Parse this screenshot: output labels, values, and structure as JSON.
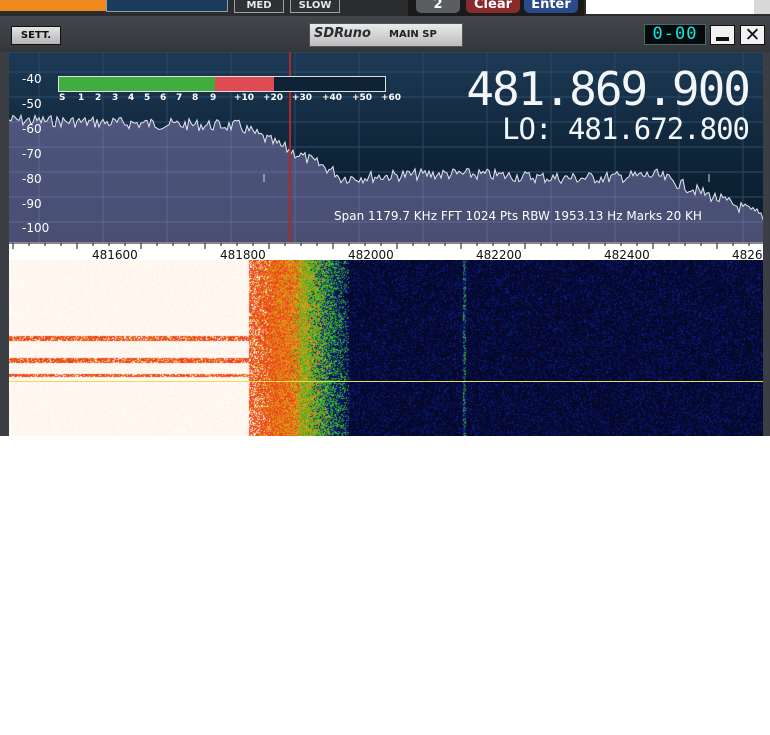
{
  "top": {
    "buttons": [
      "MED",
      "SLOW"
    ],
    "keys": [
      "2",
      "Clear",
      "Enter"
    ]
  },
  "window": {
    "sett_label": "SETT.",
    "app_name": "SDRuno",
    "panel_name": "MAIN SP",
    "clock": "0-00"
  },
  "spectrum": {
    "db_labels": [
      "-40",
      "-50",
      "-60",
      "-70",
      "-80",
      "-90",
      "-100"
    ],
    "meter": {
      "scale": [
        "S",
        "1",
        "2",
        "3",
        "4",
        "5",
        "6",
        "7",
        "8",
        "9",
        "+10",
        "+20",
        "+30",
        "+40",
        "+50",
        "+60"
      ],
      "green_fraction": 0.48,
      "red_fraction": 0.18
    },
    "frequency": "481.869.900",
    "lo": "LO: 481.672.800",
    "status": "Span 1179.7 KHz   FFT 1024 Pts   RBW 1953.13 Hz   Marks 20 KH"
  },
  "axis": {
    "labels": [
      "481600",
      "481800",
      "482000",
      "482200",
      "482400",
      "4826"
    ]
  },
  "colors": {
    "meter_green": "#3fae3f",
    "meter_red": "#e04a52",
    "spectrum_bg": "#102a40",
    "clock": "#10e8e0",
    "marker": "#c03030"
  }
}
